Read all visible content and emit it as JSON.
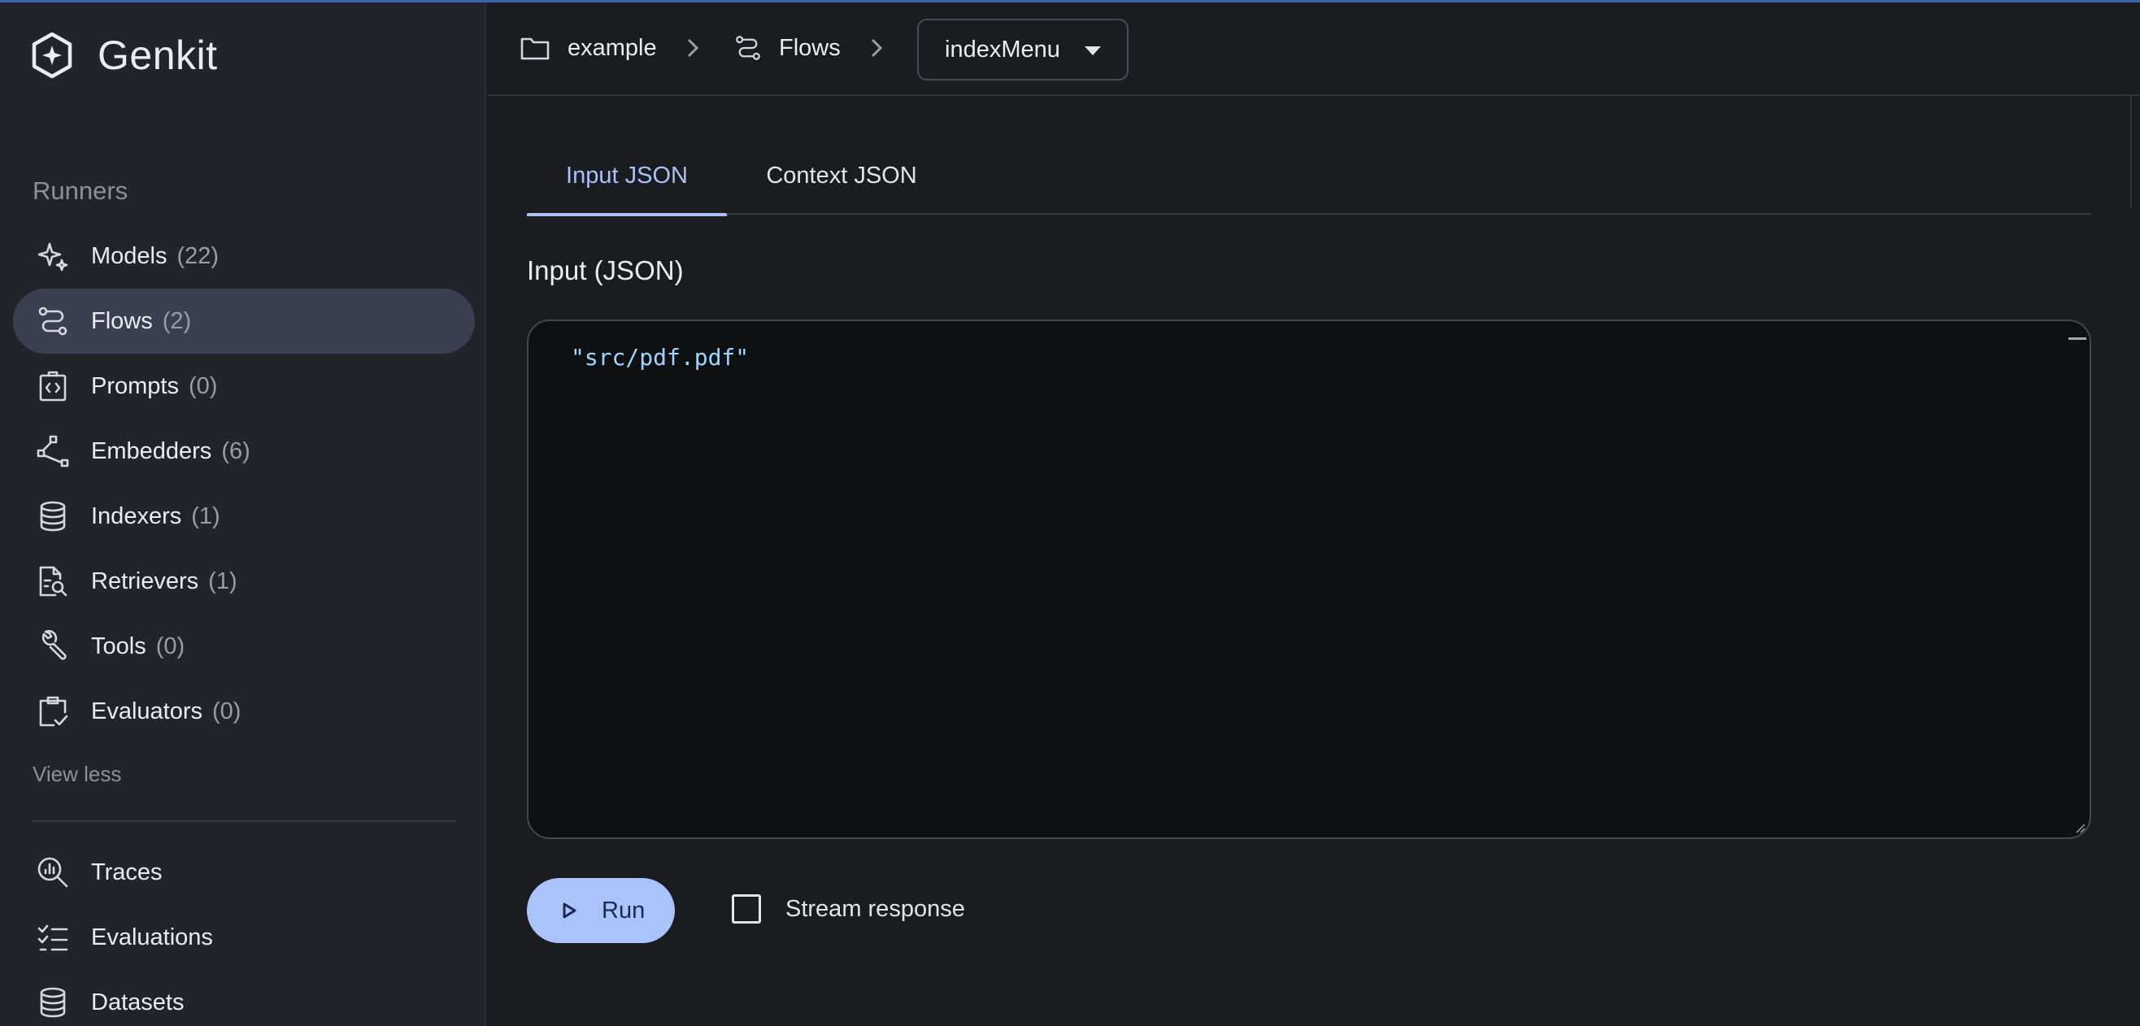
{
  "app": {
    "name": "Genkit"
  },
  "sidebar": {
    "section_title": "Runners",
    "items": [
      {
        "label": "Models",
        "count": "(22)",
        "icon": "sparkle-icon",
        "active": false
      },
      {
        "label": "Flows",
        "count": "(2)",
        "icon": "flow-icon",
        "active": true
      },
      {
        "label": "Prompts",
        "count": "(0)",
        "icon": "prompt-code-icon",
        "active": false
      },
      {
        "label": "Embedders",
        "count": "(6)",
        "icon": "embedder-icon",
        "active": false
      },
      {
        "label": "Indexers",
        "count": "(1)",
        "icon": "database-icon",
        "active": false
      },
      {
        "label": "Retrievers",
        "count": "(1)",
        "icon": "document-search-icon",
        "active": false
      },
      {
        "label": "Tools",
        "count": "(0)",
        "icon": "wrench-icon",
        "active": false
      },
      {
        "label": "Evaluators",
        "count": "(0)",
        "icon": "clipboard-check-icon",
        "active": false
      }
    ],
    "view_less": "View less",
    "bottom_items": [
      {
        "label": "Traces",
        "icon": "traces-search-icon"
      },
      {
        "label": "Evaluations",
        "icon": "checklist-icon"
      },
      {
        "label": "Datasets",
        "icon": "database-icon"
      }
    ]
  },
  "header": {
    "breadcrumb": {
      "project": "example",
      "section": "Flows"
    },
    "selected_flow": "indexMenu"
  },
  "main": {
    "tabs": [
      {
        "label": "Input JSON",
        "active": true
      },
      {
        "label": "Context JSON",
        "active": false
      }
    ],
    "input_title": "Input (JSON)",
    "input_value": "\"src/pdf.pdf\"",
    "run_label": "Run",
    "stream_label": "Stream response",
    "stream_checked": false
  },
  "colors": {
    "accent": "#aac4fb",
    "tab_active": "#a9c1f5",
    "json_string": "#9fd6ff",
    "active_nav_bg": "#3a4050"
  }
}
